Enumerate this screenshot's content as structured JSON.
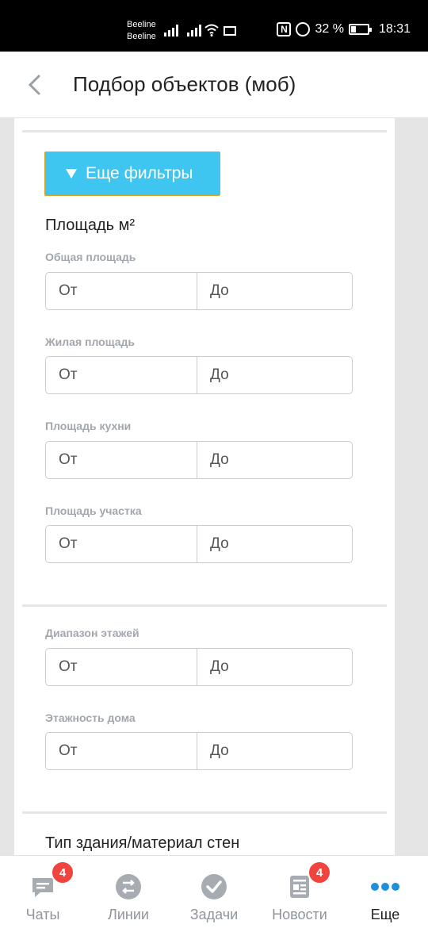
{
  "status_bar": {
    "carrier_1": "Beeline",
    "carrier_2": "Beeline",
    "battery": "32 %",
    "battery_level": 0.32,
    "time": "18:31",
    "icons": [
      "signal-icon",
      "signal-icon",
      "wifi-icon",
      "mail-icon",
      "nfc-icon",
      "alarm-icon",
      "battery-icon"
    ]
  },
  "header": {
    "title": "Подбор объектов (моб)",
    "back_icon": "chevron-left-icon"
  },
  "filters_button": {
    "label": "Еще фильтры",
    "icon": "triangle-down-icon",
    "color": "#3fc6f0"
  },
  "area_section": {
    "title": "Площадь м²",
    "fields": [
      {
        "label": "Общая площадь",
        "from_placeholder": "От",
        "to_placeholder": "До"
      },
      {
        "label": "Жилая площадь",
        "from_placeholder": "От",
        "to_placeholder": "До"
      },
      {
        "label": "Площадь кухни",
        "from_placeholder": "От",
        "to_placeholder": "До"
      },
      {
        "label": "Площадь участка",
        "from_placeholder": "От",
        "to_placeholder": "До"
      }
    ]
  },
  "floor_section": {
    "fields": [
      {
        "label": "Диапазон этажей",
        "from_placeholder": "От",
        "to_placeholder": "До"
      },
      {
        "label": "Этажность дома",
        "from_placeholder": "От",
        "to_placeholder": "До"
      }
    ]
  },
  "building_section": {
    "title": "Тип здания/материал стен"
  },
  "bottom_nav": {
    "items": [
      {
        "label": "Чаты",
        "icon": "chat-icon",
        "badge": "4"
      },
      {
        "label": "Линии",
        "icon": "lines-icon"
      },
      {
        "label": "Задачи",
        "icon": "check-icon"
      },
      {
        "label": "Новости",
        "icon": "news-icon",
        "badge": "4"
      },
      {
        "label": "Еще",
        "icon": "more-dots-icon",
        "active": true
      }
    ],
    "accent_color": "#1e8fdb",
    "badge_color": "#f0443f"
  }
}
